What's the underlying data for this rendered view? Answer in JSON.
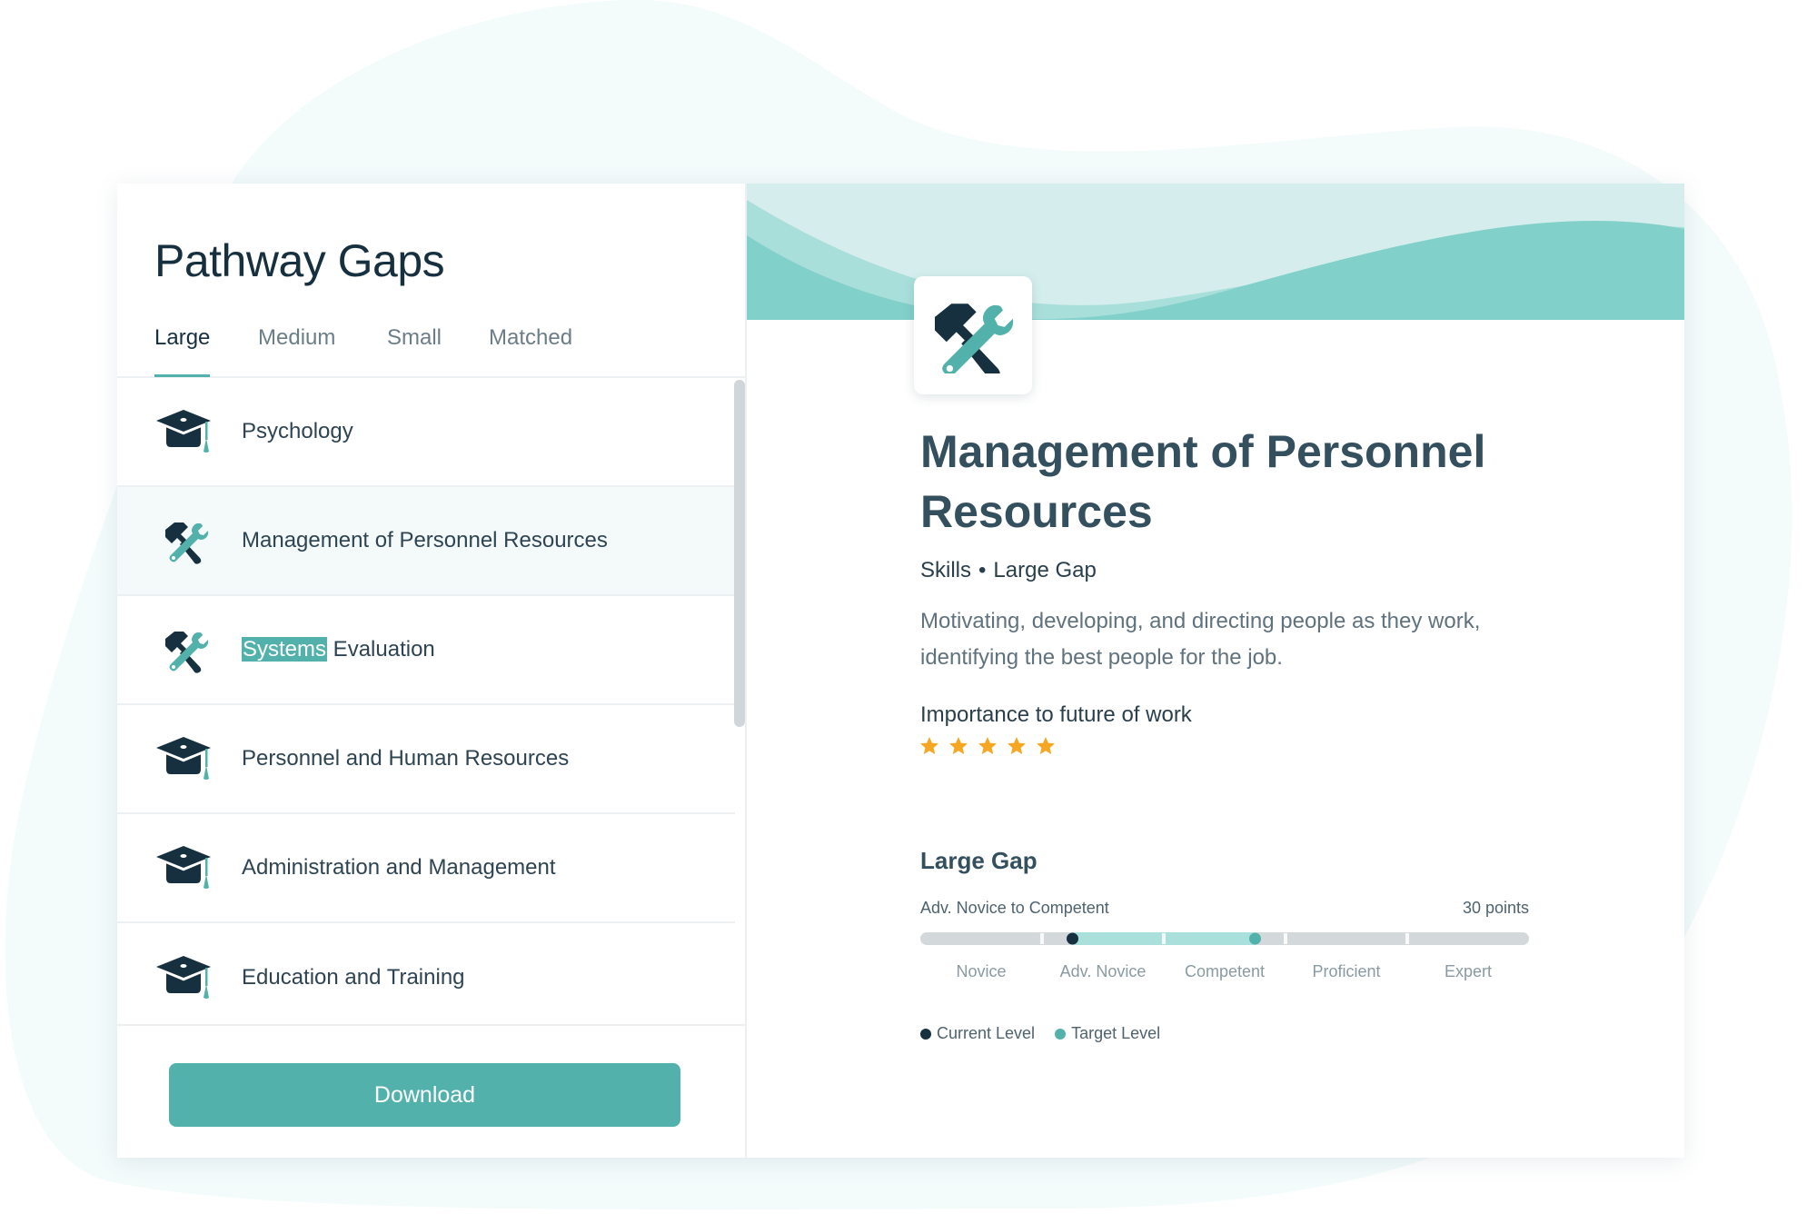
{
  "colors": {
    "accent": "#52b2ab",
    "accent_light": "#a9e0dc",
    "dark": "#17303f",
    "track": "#d3d8db",
    "star": "#f5a623",
    "wave_light": "#d5eeed",
    "wave_mid": "#a9dfdb",
    "wave_dark": "#82d0ca",
    "background_blob": "#f3fbfb"
  },
  "left_panel": {
    "title": "Pathway Gaps",
    "tabs": [
      {
        "label": "Large",
        "active": true
      },
      {
        "label": "Medium",
        "active": false
      },
      {
        "label": "Small",
        "active": false
      },
      {
        "label": "Matched",
        "active": false
      }
    ],
    "items": [
      {
        "label": "Psychology",
        "icon": "graduation-cap-icon",
        "selected": false
      },
      {
        "label": "Management of Personnel Resources",
        "icon": "tools-icon",
        "selected": true
      },
      {
        "label_highlight": "Systems",
        "label_rest": " Evaluation",
        "icon": "tools-icon",
        "selected": false
      },
      {
        "label": "Personnel and Human Resources",
        "icon": "graduation-cap-icon",
        "selected": false
      },
      {
        "label": "Administration and Management",
        "icon": "graduation-cap-icon",
        "selected": false
      },
      {
        "label": "Education and Training",
        "icon": "graduation-cap-icon",
        "selected": false
      }
    ],
    "download_label": "Download"
  },
  "detail": {
    "icon": "tools-icon",
    "title": "Management of Personnel Resources",
    "category": "Skills",
    "separator": "•",
    "gap_size": "Large Gap",
    "description": "Motivating, developing, and directing people as they work, identifying the best people for the job.",
    "importance_label": "Importance to future of work",
    "importance_rating": 5,
    "importance_max": 5,
    "gap": {
      "heading": "Large Gap",
      "range_text": "Adv. Novice to Competent",
      "points_text": "30 points",
      "levels": [
        "Novice",
        "Adv. Novice",
        "Competent",
        "Proficient",
        "Expert"
      ],
      "current_position": 0.25,
      "target_position": 0.55,
      "legend": [
        {
          "label": "Current Level",
          "color": "#17303f"
        },
        {
          "label": "Target Level",
          "color": "#52b2ab"
        }
      ]
    }
  }
}
